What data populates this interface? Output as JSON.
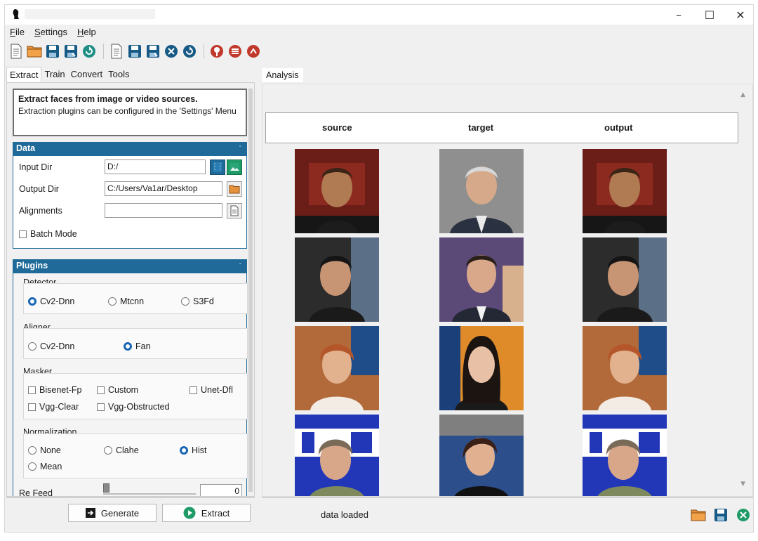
{
  "window": {
    "title": "",
    "controls": {
      "minimize": "–",
      "maximize": "☐",
      "close": "✕"
    }
  },
  "menu": [
    {
      "label": "File",
      "accel": "F",
      "rest": "ile"
    },
    {
      "label": "Settings",
      "accel": "S",
      "rest": "ettings"
    },
    {
      "label": "Help",
      "accel": "H",
      "rest": "elp"
    }
  ],
  "toolbar": {
    "icons": [
      "new-document-icon",
      "open-folder-icon",
      "save-icon",
      "save-as-icon",
      "reload-icon",
      "new-task-icon",
      "save-task-icon",
      "save-task-as-icon",
      "clear-icon",
      "reload-task-icon",
      "pin-icon",
      "list-icon",
      "sync-icon"
    ]
  },
  "left_tabs": [
    "Extract",
    "Train",
    "Convert",
    "Tools"
  ],
  "active_left_tab": "Extract",
  "info": {
    "heading": "Extract faces from image or video sources.",
    "body": "Extraction plugins can be configured in the 'Settings' Menu"
  },
  "data_section": {
    "title": "Data",
    "collapse": "-",
    "input_dir": {
      "label": "Input Dir",
      "value": "D:/"
    },
    "output_dir": {
      "label": "Output Dir",
      "value": "C:/Users/Va1ar/Desktop"
    },
    "alignments": {
      "label": "Alignments",
      "value": ""
    },
    "batch_mode": {
      "label": "Batch Mode",
      "checked": false
    }
  },
  "plugins_section": {
    "title": "Plugins",
    "collapse": "-",
    "detector": {
      "label": "Detector",
      "options": [
        "Cv2-Dnn",
        "Mtcnn",
        "S3Fd"
      ],
      "selected": "Cv2-Dnn"
    },
    "aligner": {
      "label": "Aligner",
      "options": [
        "Cv2-Dnn",
        "Fan"
      ],
      "selected": "Fan"
    },
    "masker": {
      "label": "Masker",
      "options": [
        "Bisenet-Fp",
        "Custom",
        "Unet-Dfl",
        "Vgg-Clear",
        "Vgg-Obstructed"
      ]
    },
    "normalization": {
      "label": "Normalization",
      "options": [
        "None",
        "Clahe",
        "Hist",
        "Mean"
      ],
      "selected": "Hist"
    },
    "re_feed": {
      "label": "Re Feed",
      "value": "0"
    }
  },
  "actions": {
    "generate": "Generate",
    "extract": "Extract"
  },
  "analysis": {
    "tab": "Analysis",
    "columns": [
      "source",
      "target",
      "output"
    ]
  },
  "status": {
    "text": "data loaded"
  },
  "colors": {
    "accent": "#1f6a98",
    "radio": "#1a66b5",
    "green": "#1f9b68"
  }
}
